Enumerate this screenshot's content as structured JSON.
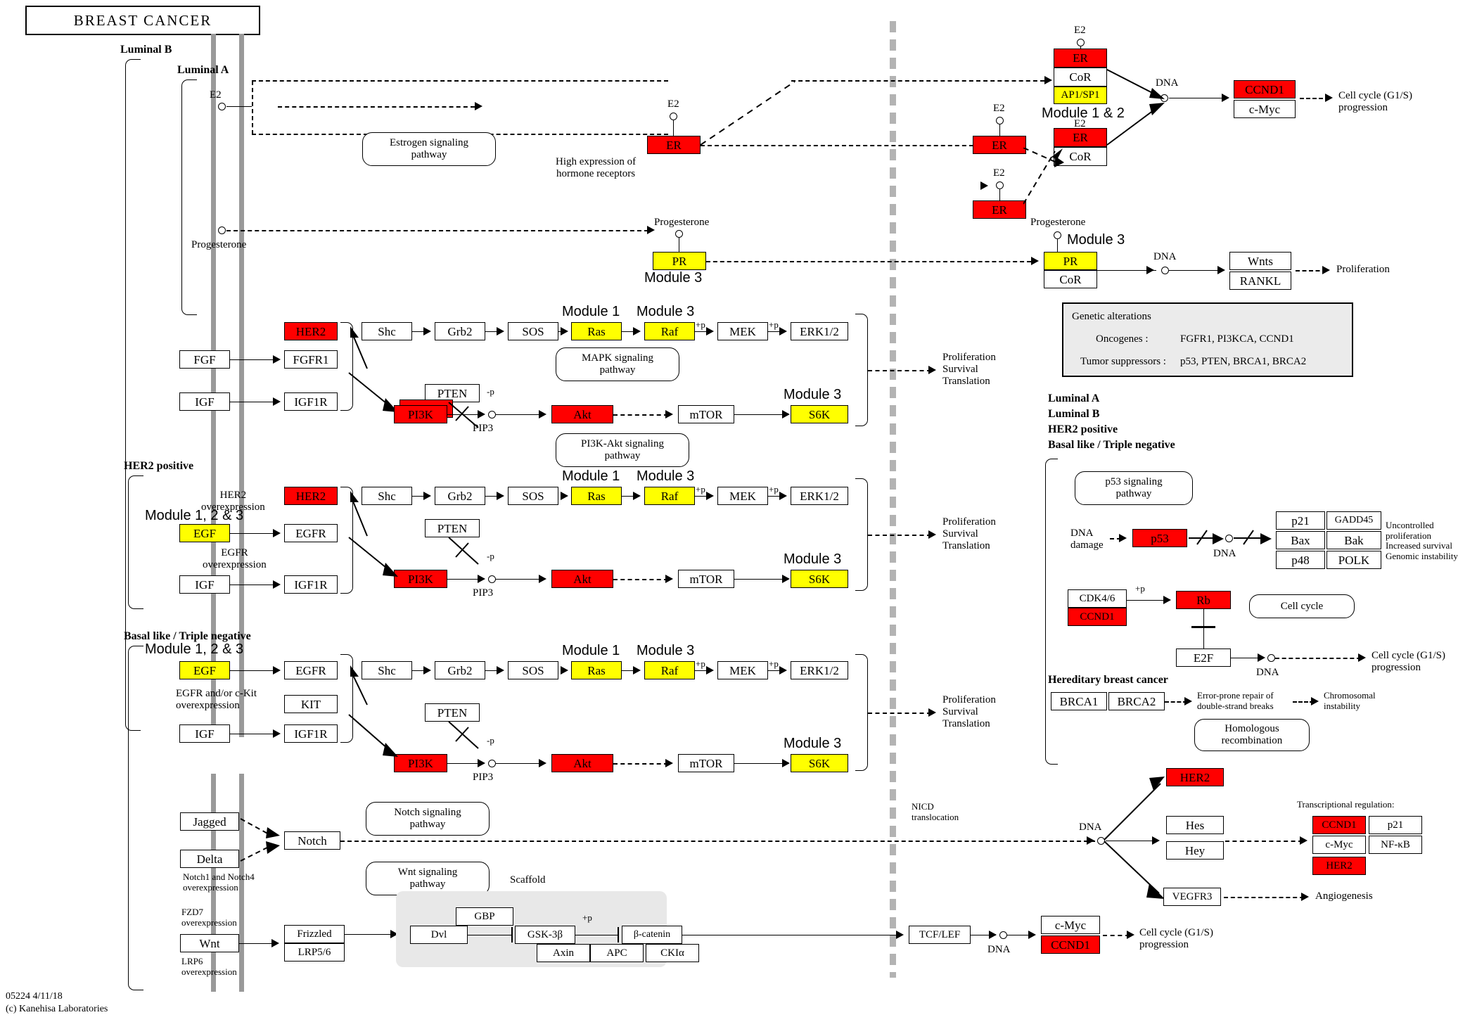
{
  "title": "BREAST  CANCER",
  "footer": {
    "line1": "05224 4/11/18",
    "line2": "(c) Kanehisa Laboratories"
  },
  "colors": {
    "red": "#ff0000",
    "yellow": "#ffff00",
    "membrane": "#999999",
    "panel": "#ebebeb",
    "scaffold": "#e8e8e8"
  },
  "subtype_labels": {
    "luminal_b": "Luminal B",
    "luminal_a": "Luminal A",
    "her2_positive": "HER2 positive",
    "basal": "Basal like / Triple negative"
  },
  "legend_subtypes": [
    "Luminal A",
    "Luminal B",
    "HER2 positive",
    "Basal like / Triple negative"
  ],
  "genetic_alterations": {
    "header": "Genetic alterations",
    "oncogenes_label": "Oncogenes :",
    "oncogenes_value": "FGFR1, PI3KCA, CCND1",
    "suppressors_label": "Tumor suppressors :",
    "suppressors_value": "p53, PTEN, BRCA1, BRCA2"
  },
  "hormone": {
    "e2": "E2",
    "progesterone": "Progesterone",
    "estrogen_pathway": "Estrogen signaling\npathway",
    "high_expression": "High expression of\nhormone receptors",
    "er": "ER",
    "cor": "CoR",
    "ap1sp1": "AP1/SP1",
    "pr": "PR",
    "module_1_2": "Module 1 & 2",
    "module_3": "Module 3",
    "dna": "DNA",
    "ccnd1": "CCND1",
    "cmyc": "c-Myc",
    "wnts": "Wnts",
    "rankl": "RANKL",
    "cell_cycle_prog": "Cell cycle (G1/S)\nprogression",
    "proliferation": "Proliferation"
  },
  "rtk_rows": [
    {
      "id": "luminal",
      "ligands": [
        "FGF",
        "IGF"
      ],
      "receptors": [
        "HER2",
        "FGFR1",
        "IGF1R"
      ],
      "receptor_colors": [
        "red",
        "white",
        "white"
      ],
      "notes": []
    },
    {
      "id": "her2",
      "ligands": [
        "EGF",
        "IGF"
      ],
      "receptors": [
        "HER2",
        "EGFR",
        "IGF1R"
      ],
      "receptor_colors": [
        "red",
        "white",
        "white"
      ],
      "notes": [
        "HER2\noverexpression",
        "EGFR\noverexpression"
      ],
      "module": "Module 1, 2 & 3"
    },
    {
      "id": "basal",
      "ligands": [
        "EGF",
        "IGF"
      ],
      "receptors": [
        "EGFR",
        "KIT",
        "IGF1R"
      ],
      "receptor_colors": [
        "white",
        "white",
        "white"
      ],
      "notes": [
        "EGFR and/or c-Kit\noverexpression"
      ],
      "module": "Module 1, 2 & 3"
    }
  ],
  "cascade": {
    "mapk": [
      "Shc",
      "Grb2",
      "SOS",
      "Ras",
      "Raf",
      "MEK",
      "ERK1/2"
    ],
    "mapk_module_1": "Module 1",
    "mapk_module_3": "Module 3",
    "phos": "+p",
    "dephos": "-p",
    "pten": "PTEN",
    "pi3k": "PI3K",
    "pip3": "PIP3",
    "akt": "Akt",
    "mtor": "mTOR",
    "s6k": "S6K",
    "s6k_module": "Module 3",
    "mapk_pathway": "MAPK signaling\npathway",
    "pi3k_pathway": "PI3K-Akt signaling\npathway",
    "outcome": "Proliferation\nSurvival\nTranslation"
  },
  "notch": {
    "jagged": "Jagged",
    "delta": "Delta",
    "notch": "Notch",
    "pathway": "Notch signaling\npathway",
    "note": "Notch1 and Notch4\noverexpression",
    "nicd": "NICD\ntranslocation",
    "dna": "DNA",
    "her2": "HER2",
    "hes": "Hes",
    "hey": "Hey",
    "vegfr3": "VEGFR3",
    "angiogenesis": "Angiogenesis",
    "transcriptional_regulation": "Transcriptional regulation:",
    "targets": [
      "CCND1",
      "p21",
      "c-Myc",
      "NF-κB",
      "HER2"
    ]
  },
  "wnt": {
    "wnt": "Wnt",
    "frizzled": "Frizzled",
    "lrp56": "LRP5/6",
    "fzd7_note": "FZD7\noverexpression",
    "lrp6_note": "LRP6\noverexpression",
    "pathway": "Wnt signaling\npathway",
    "scaffold": "Scaffold",
    "dvl": "Dvl",
    "gbp": "GBP",
    "gsk3b": "GSK-3β",
    "axin": "Axin",
    "apc": "APC",
    "bcatenin": "β-catenin",
    "ckia": "CKIα",
    "phos": "+p",
    "tcflef": "TCF/LEF",
    "dna": "DNA",
    "cmyc": "c-Myc",
    "ccnd1": "CCND1",
    "cell_cycle_prog": "Cell cycle (G1/S)\nprogression"
  },
  "p53": {
    "pathway": "p53 signaling\npathway",
    "dna_damage": "DNA\ndamage",
    "p53": "p53",
    "dna": "DNA",
    "targets": [
      "p21",
      "GADD45",
      "Bax",
      "Bak",
      "p48",
      "POLK"
    ],
    "outcome": "Uncontrolled proliferation\nIncreased survival\nGenomic instability",
    "cdk46": "CDK4/6",
    "ccnd1": "CCND1",
    "phos": "+p",
    "rb": "Rb",
    "e2f": "E2F",
    "cell_cycle": "Cell cycle",
    "cell_cycle_prog": "Cell cycle (G1/S)\nprogression"
  },
  "hereditary": {
    "header": "Hereditary breast cancer",
    "brca1": "BRCA1",
    "brca2": "BRCA2",
    "error_repair": "Error-prone repair of\ndouble-strand breaks",
    "chromosomal": "Chromosomal\ninstability",
    "homologous": "Homologous\nrecombination"
  }
}
